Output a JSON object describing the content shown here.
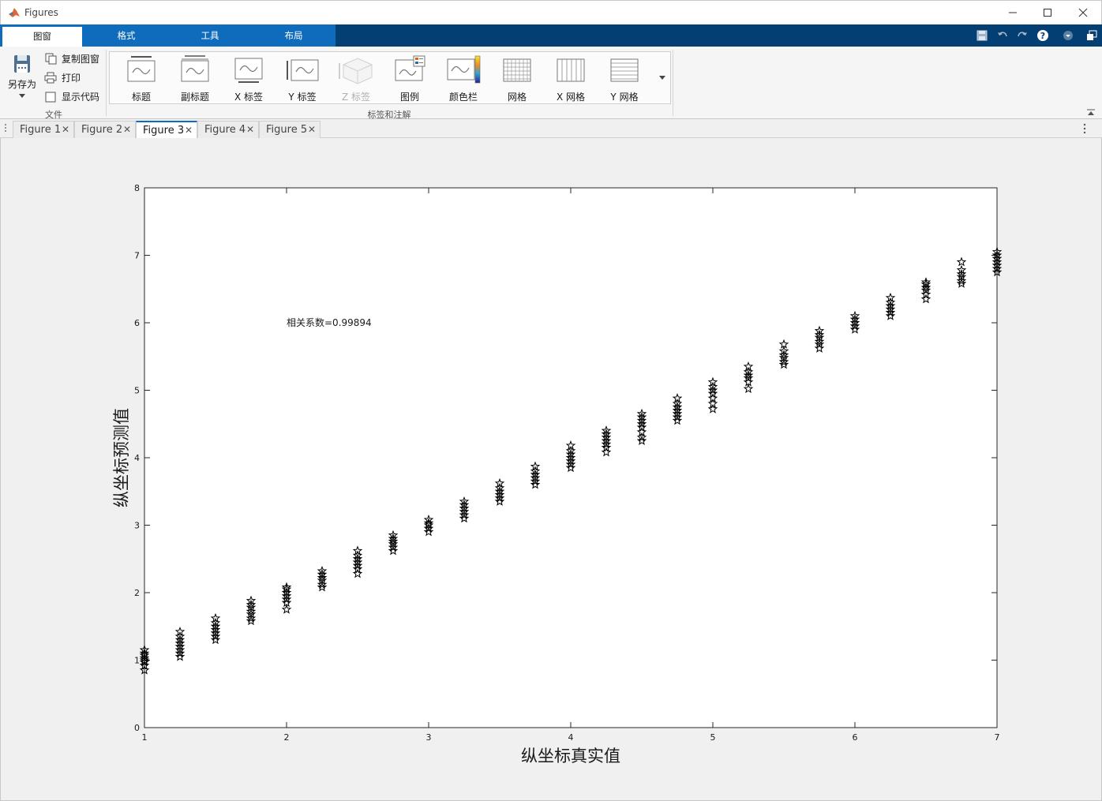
{
  "window": {
    "title": "Figures",
    "icon": "matlab-logo-icon",
    "controls": [
      "minimize-icon",
      "maximize-icon",
      "close-icon"
    ]
  },
  "ribbon_tabs": [
    {
      "label": "图窗",
      "active": true
    },
    {
      "label": "格式",
      "active": false
    },
    {
      "label": "工具",
      "active": false
    },
    {
      "label": "布局",
      "active": false
    }
  ],
  "quick_access": [
    "save-icon",
    "undo-icon",
    "redo-icon",
    "help-icon",
    "dropdown-icon",
    "undock-icon"
  ],
  "file_group": {
    "label": "文件",
    "save_as": "另存为",
    "copy_figure": "复制图窗",
    "print": "打印",
    "show_code": "显示代码",
    "show_code_checked": false
  },
  "annotation_group": {
    "label": "标签和注解",
    "items": [
      {
        "label": "标题",
        "icon": "title-icon",
        "enabled": true
      },
      {
        "label": "副标题",
        "icon": "subtitle-icon",
        "enabled": true
      },
      {
        "label": "X 标签",
        "icon": "xlabel-icon",
        "enabled": true
      },
      {
        "label": "Y 标签",
        "icon": "ylabel-icon",
        "enabled": true
      },
      {
        "label": "Z 标签",
        "icon": "zlabel-icon",
        "enabled": false
      },
      {
        "label": "图例",
        "icon": "legend-icon",
        "enabled": true
      },
      {
        "label": "颜色栏",
        "icon": "colorbar-icon",
        "enabled": true
      },
      {
        "label": "网格",
        "icon": "grid-icon",
        "enabled": true
      },
      {
        "label": "X 网格",
        "icon": "xgrid-icon",
        "enabled": true
      },
      {
        "label": "Y 网格",
        "icon": "ygrid-icon",
        "enabled": true
      }
    ]
  },
  "figure_tabs": [
    {
      "label": "Figure 1",
      "active": false
    },
    {
      "label": "Figure 2",
      "active": false
    },
    {
      "label": "Figure 3",
      "active": true
    },
    {
      "label": "Figure 4",
      "active": false
    },
    {
      "label": "Figure 5",
      "active": false
    }
  ],
  "chart_data": {
    "type": "scatter",
    "xlabel": "纵坐标真实值",
    "ylabel": "纵坐标预测值",
    "xlim": [
      1,
      7
    ],
    "ylim": [
      0,
      8
    ],
    "xticks": [
      1,
      2,
      3,
      4,
      5,
      6,
      7
    ],
    "yticks": [
      0,
      1,
      2,
      3,
      4,
      5,
      6,
      7,
      8
    ],
    "grid": false,
    "marker": "pentagram",
    "marker_color": "#000000",
    "annotation": {
      "text": "相关系数=0.99894",
      "x": 2,
      "y": 6
    },
    "series": [
      {
        "points": [
          [
            1.0,
            [
              0.85,
              0.92,
              0.97,
              1.0,
              1.03,
              1.07,
              1.1,
              1.15
            ]
          ],
          [
            1.25,
            [
              1.05,
              1.1,
              1.15,
              1.2,
              1.25,
              1.3,
              1.35,
              1.42
            ]
          ],
          [
            1.5,
            [
              1.3,
              1.35,
              1.4,
              1.45,
              1.5,
              1.55,
              1.62
            ]
          ],
          [
            1.75,
            [
              1.58,
              1.62,
              1.68,
              1.72,
              1.78,
              1.82,
              1.88
            ]
          ],
          [
            2.0,
            [
              1.75,
              1.85,
              1.9,
              1.95,
              2.0,
              2.05,
              2.08
            ]
          ],
          [
            2.25,
            [
              2.08,
              2.12,
              2.18,
              2.22,
              2.27,
              2.32
            ]
          ],
          [
            2.5,
            [
              2.28,
              2.35,
              2.4,
              2.45,
              2.5,
              2.55,
              2.62
            ]
          ],
          [
            2.75,
            [
              2.62,
              2.67,
              2.72,
              2.76,
              2.8,
              2.85
            ]
          ],
          [
            3.0,
            [
              2.9,
              2.95,
              3.0,
              3.03,
              3.08
            ]
          ],
          [
            3.25,
            [
              3.1,
              3.15,
              3.2,
              3.25,
              3.3,
              3.35
            ]
          ],
          [
            3.5,
            [
              3.35,
              3.4,
              3.45,
              3.5,
              3.55,
              3.62
            ]
          ],
          [
            3.75,
            [
              3.6,
              3.65,
              3.7,
              3.75,
              3.8,
              3.87
            ]
          ],
          [
            4.0,
            [
              3.85,
              3.9,
              3.95,
              4.0,
              4.05,
              4.1,
              4.18
            ]
          ],
          [
            4.25,
            [
              4.08,
              4.15,
              4.2,
              4.25,
              4.3,
              4.35,
              4.4
            ]
          ],
          [
            4.5,
            [
              4.25,
              4.3,
              4.38,
              4.45,
              4.5,
              4.55,
              4.6,
              4.65
            ]
          ],
          [
            4.75,
            [
              4.55,
              4.6,
              4.65,
              4.7,
              4.75,
              4.8,
              4.88
            ]
          ],
          [
            5.0,
            [
              4.72,
              4.8,
              4.88,
              4.95,
              5.0,
              5.05,
              5.12
            ]
          ],
          [
            5.25,
            [
              5.02,
              5.12,
              5.18,
              5.22,
              5.27,
              5.35
            ]
          ],
          [
            5.5,
            [
              5.38,
              5.42,
              5.48,
              5.52,
              5.58,
              5.68
            ]
          ],
          [
            5.75,
            [
              5.62,
              5.68,
              5.72,
              5.78,
              5.82,
              5.88
            ]
          ],
          [
            6.0,
            [
              5.9,
              5.95,
              6.0,
              6.05,
              6.1
            ]
          ],
          [
            6.25,
            [
              6.1,
              6.15,
              6.2,
              6.25,
              6.3,
              6.37
            ]
          ],
          [
            6.5,
            [
              6.35,
              6.42,
              6.48,
              6.52,
              6.57,
              6.6
            ]
          ],
          [
            6.75,
            [
              6.58,
              6.62,
              6.68,
              6.72,
              6.78,
              6.9
            ]
          ],
          [
            7.0,
            [
              6.75,
              6.8,
              6.85,
              6.9,
              6.95,
              7.0,
              7.05
            ]
          ]
        ]
      }
    ]
  }
}
